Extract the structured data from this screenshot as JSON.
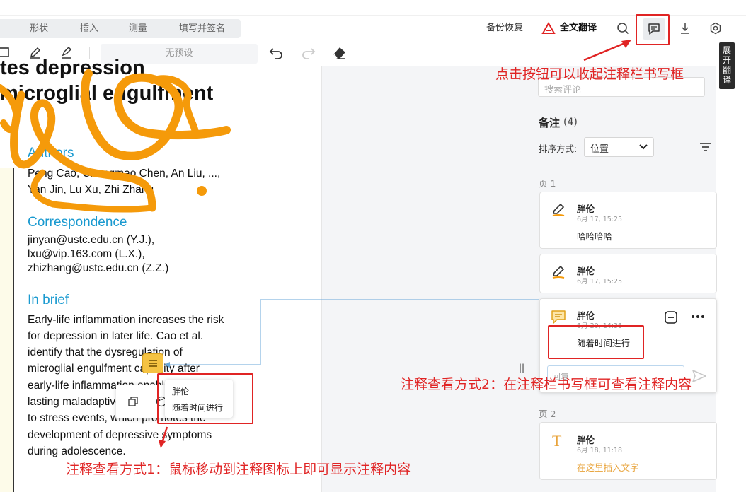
{
  "toolbar": {
    "tabs": [
      "形状",
      "插入",
      "测量",
      "填写并签名"
    ],
    "backup": "备份恢复",
    "translate": "全文翻译",
    "preset": "无预设"
  },
  "document": {
    "title_line1": "tes depression",
    "title_line2": "microglial engulfment",
    "authors_heading": "Authors",
    "authors_line1": "Peng Cao, Changmao Chen, An Liu, ...,",
    "authors_line2": "Yan Jin, Lu Xu, Zhi Zhang",
    "corr_heading": "Correspondence",
    "corr_line1": "jinyan@ustc.edu.cn (Y.J.),",
    "corr_line2": "lxu@vip.163.com (L.X.),",
    "corr_line3": "zhizhang@ustc.edu.cn (Z.Z.)",
    "brief_heading": "In brief",
    "brief_lines": [
      "Early-life inflammation increases the risk",
      "for depression in later life. Cao et al.",
      "identify that the dysregulation of",
      "microglial engulfment capacity after",
      "early-life inflammation enables",
      "lasting maladaptive behavioral reactions",
      "to stress events, which promotes the",
      "development of depressive symptoms",
      "during adolescence."
    ]
  },
  "hover_popup": {
    "name": "胖伦",
    "content": "随着时间进行"
  },
  "panel": {
    "search_placeholder": "搜索评论",
    "notes_title": "备注",
    "notes_count": "(4)",
    "sort_label": "排序方式:",
    "sort_value": "位置",
    "page1": "页 1",
    "page2": "页 2",
    "reply_placeholder": "回复",
    "cards": [
      {
        "name": "胖伦",
        "date": "6月 17, 15:25",
        "text": "哈哈哈哈",
        "icon": "pencil-icon"
      },
      {
        "name": "胖伦",
        "date": "6月 17, 15:25",
        "text": "",
        "icon": "pencil-icon"
      },
      {
        "name": "胖伦",
        "date": "6月 20, 14:36",
        "text": "随着时间进行",
        "icon": "comment-icon"
      },
      {
        "name": "胖伦",
        "date": "6月 18, 11:18",
        "text": "在这里插入文字",
        "icon": "text-icon"
      }
    ]
  },
  "expand_tab": "展开翻译",
  "annotations": {
    "top": "点击按钮可以收起注释栏书写框",
    "method2": "注释查看方式2：在注释栏书写框可查看注释内容",
    "method1": "注释查看方式1：鼠标移动到注释图标上即可显示注释内容"
  },
  "colors": {
    "accent_blue": "#1a9ad0",
    "annotation_red": "#e02424",
    "scribble_orange": "#f59a0a",
    "insert_text_orange": "#e8a33a"
  }
}
